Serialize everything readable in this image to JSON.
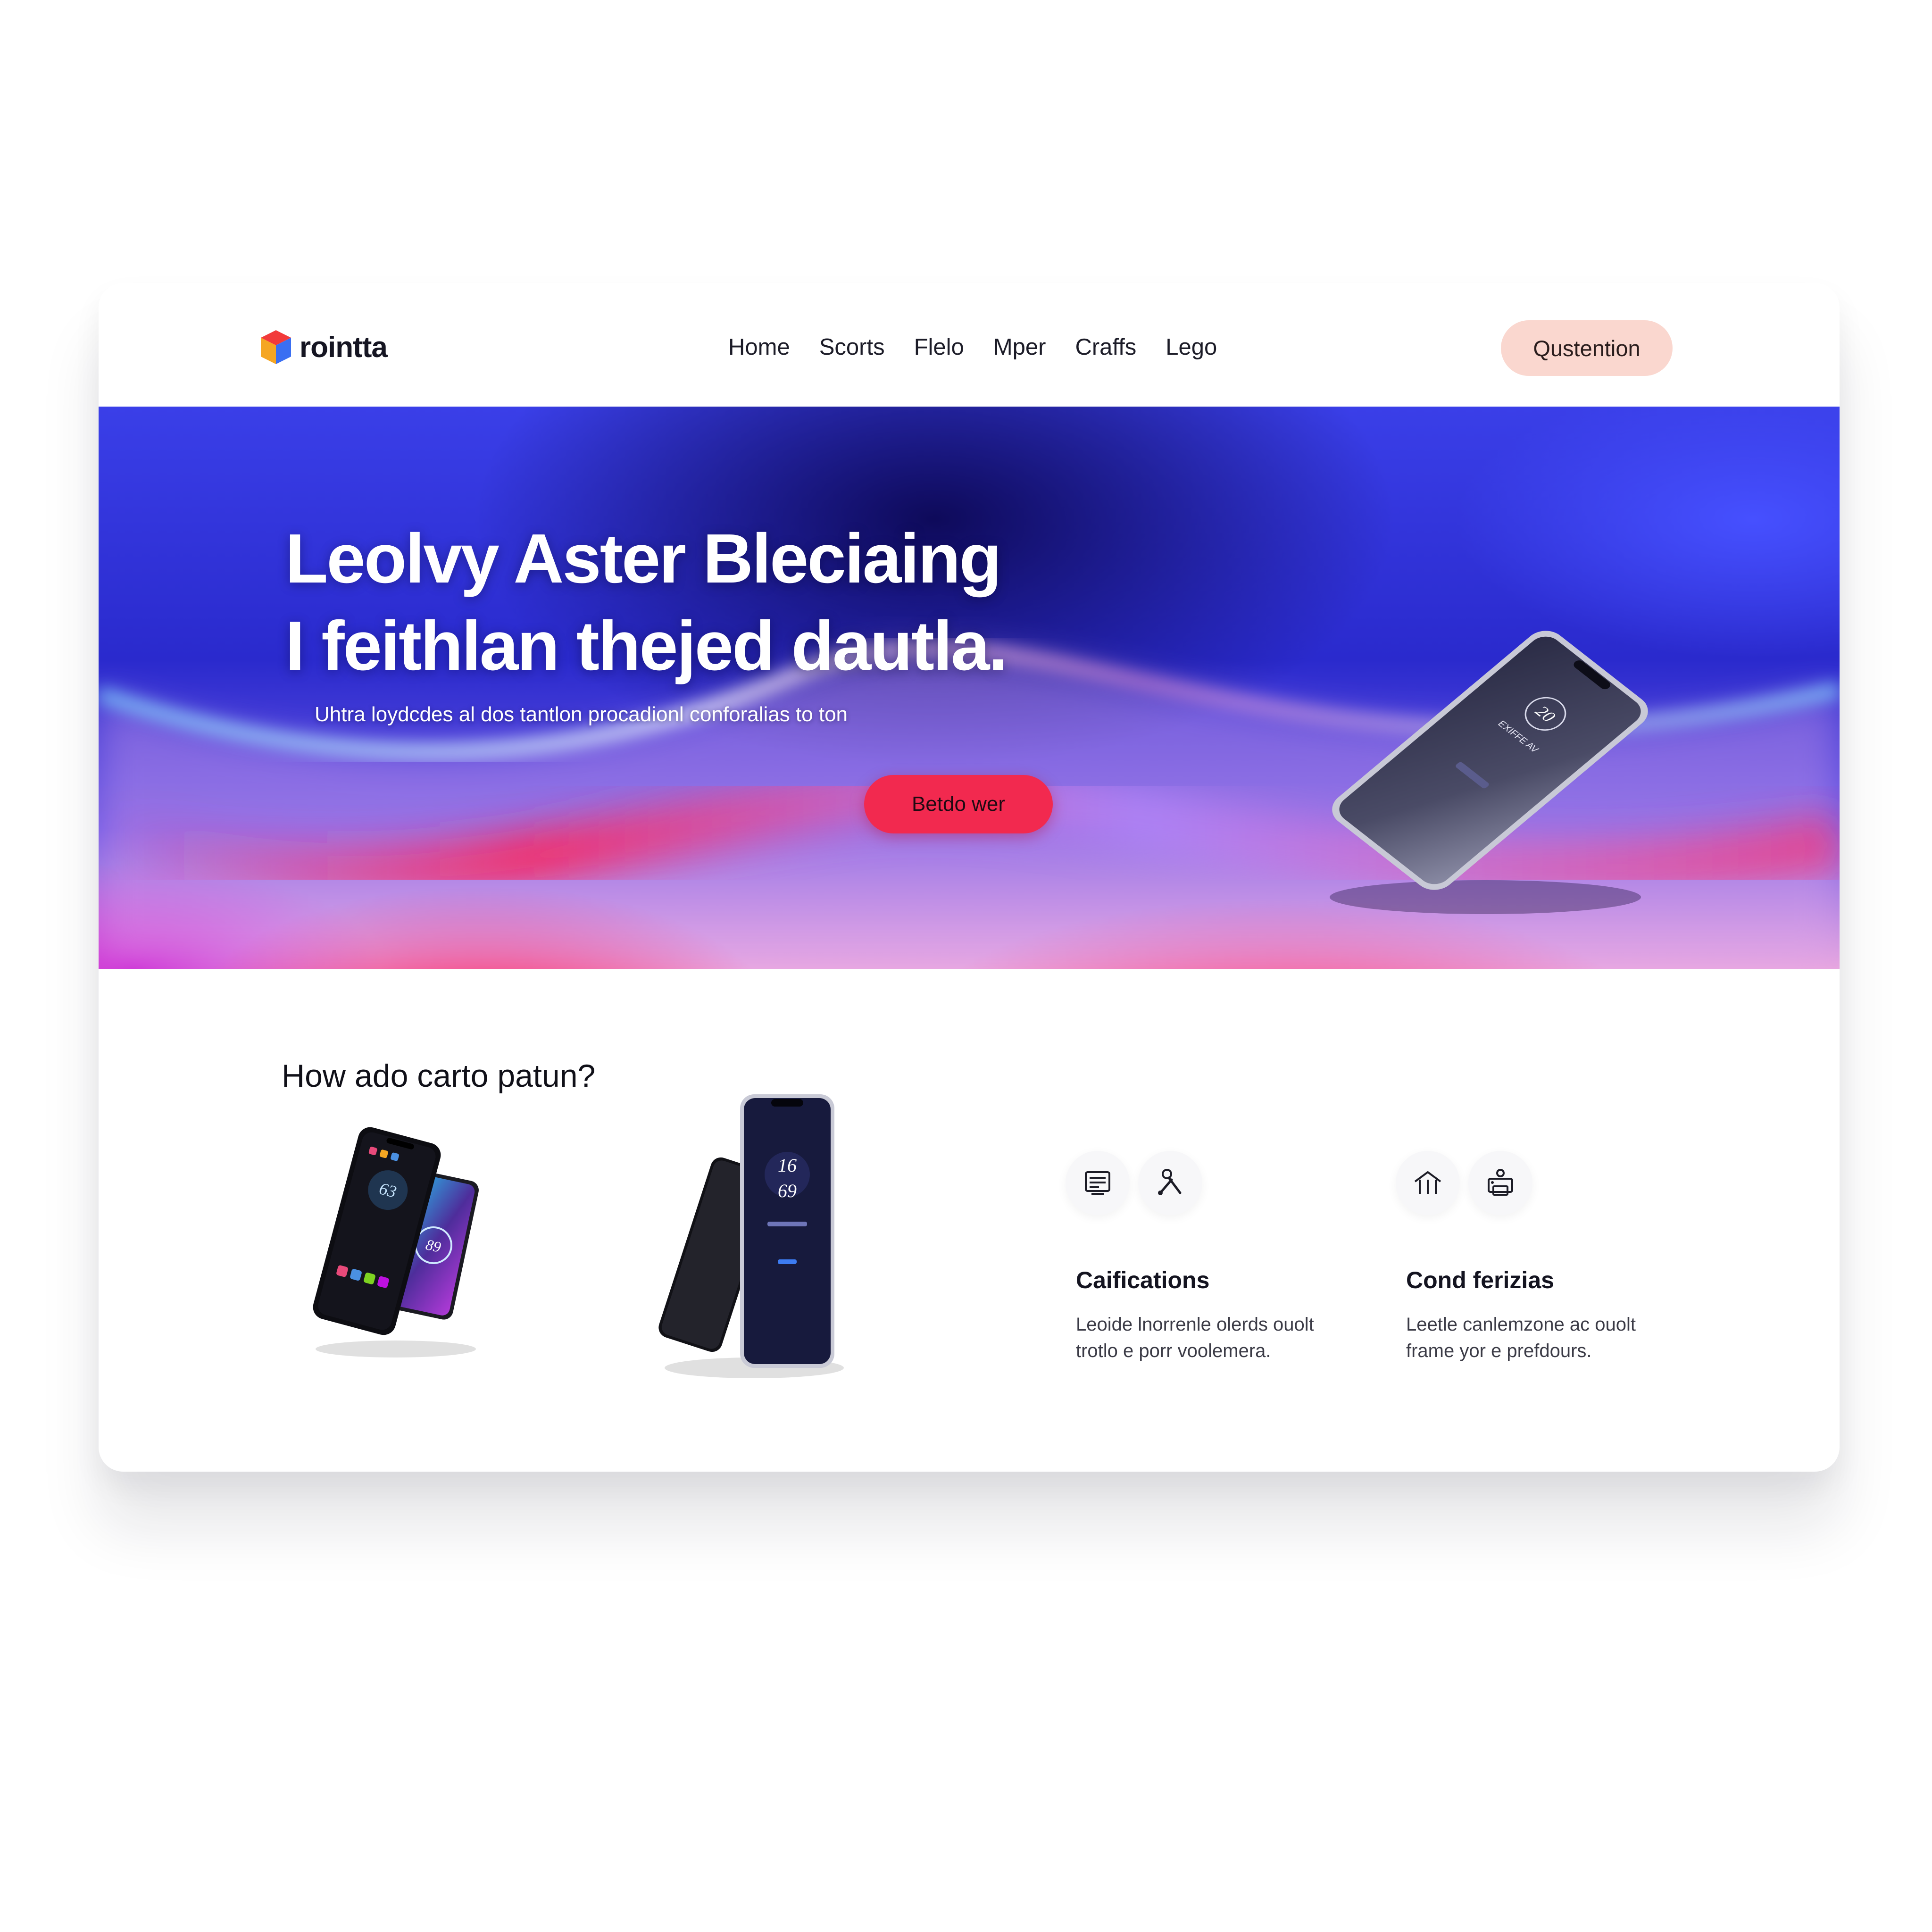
{
  "header": {
    "brand_name": "rointta",
    "logo_icon": "cube-icon",
    "nav": [
      "Home",
      "Scorts",
      "Flelo",
      "Mper",
      "Craffs",
      "Lego"
    ],
    "cta_label": "Qustention"
  },
  "hero": {
    "title_line1": "Leolvy Aster Bleciaing",
    "title_line2": "I feithlan thejed dautla.",
    "subtitle": "Uhtra loydcdes al dos tantlon procadionl conforalias to ton",
    "cta_label": "Betdo wer",
    "phone_screen_number": "20",
    "phone_screen_caption": "EXIFFE AV"
  },
  "section": {
    "title": "How ado carto patun?",
    "phone_a_numbers": [
      "63",
      "89"
    ],
    "phone_b_numbers": [
      "16",
      "69"
    ],
    "features": [
      {
        "title": "Caifications",
        "text": "Leoide lnorrenle olerds ouolt\ntrotlo e porr voolemera.",
        "icons": [
          "document-icon",
          "tools-icon"
        ]
      },
      {
        "title": "Cond ferizias",
        "text": "Leetle canlemzone ac ouolt\nframe yor e prefdours.",
        "icons": [
          "house-icon",
          "printer-icon"
        ]
      }
    ]
  },
  "colors": {
    "accent_red": "#f2294f",
    "header_cta_bg": "#fad7cf",
    "hero_deep_blue": "#0e0a5a",
    "hero_bright_blue": "#3a3fe8"
  }
}
